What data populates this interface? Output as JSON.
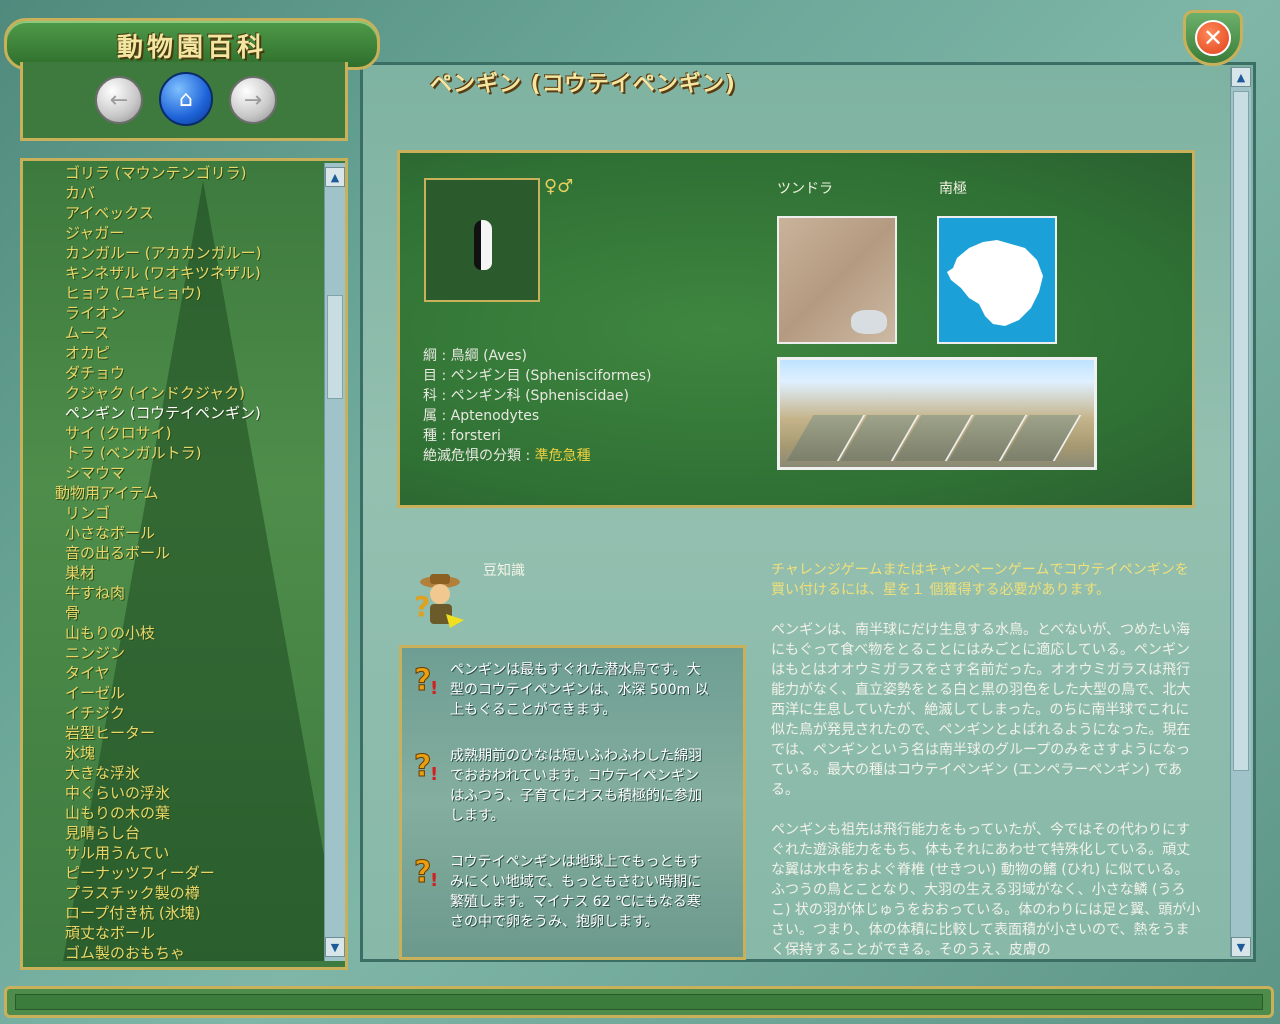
{
  "app": {
    "title": "動物園百科"
  },
  "nav": {
    "back_label": "←",
    "home_label": "⌂",
    "forward_label": "→"
  },
  "close": {
    "label": "✕"
  },
  "sidebar": {
    "items": [
      {
        "label": "ゴリラ (マウンテンゴリラ)",
        "indent": 1
      },
      {
        "label": "カバ",
        "indent": 1
      },
      {
        "label": "アイベックス",
        "indent": 1
      },
      {
        "label": "ジャガー",
        "indent": 1
      },
      {
        "label": "カンガルー (アカカンガルー)",
        "indent": 1
      },
      {
        "label": "キンネザル (ワオキツネザル)",
        "indent": 1
      },
      {
        "label": "ヒョウ (ユキヒョウ)",
        "indent": 1
      },
      {
        "label": "ライオン",
        "indent": 1
      },
      {
        "label": "ムース",
        "indent": 1
      },
      {
        "label": "オカピ",
        "indent": 1
      },
      {
        "label": "ダチョウ",
        "indent": 1
      },
      {
        "label": "クジャク (インドクジャク)",
        "indent": 1
      },
      {
        "label": "ペンギン (コウテイペンギン)",
        "indent": 1,
        "selected": true
      },
      {
        "label": "サイ (クロサイ)",
        "indent": 1
      },
      {
        "label": "トラ (ベンガルトラ)",
        "indent": 1
      },
      {
        "label": "シマウマ",
        "indent": 1
      },
      {
        "label": "動物用アイテム",
        "indent": 0
      },
      {
        "label": "リンゴ",
        "indent": 1
      },
      {
        "label": "小さなボール",
        "indent": 1
      },
      {
        "label": "音の出るボール",
        "indent": 1
      },
      {
        "label": "巣材",
        "indent": 1
      },
      {
        "label": "牛すね肉",
        "indent": 1
      },
      {
        "label": "骨",
        "indent": 1
      },
      {
        "label": "山もりの小枝",
        "indent": 1
      },
      {
        "label": "ニンジン",
        "indent": 1
      },
      {
        "label": "タイヤ",
        "indent": 1
      },
      {
        "label": "イーゼル",
        "indent": 1
      },
      {
        "label": "イチジク",
        "indent": 1
      },
      {
        "label": "岩型ヒーター",
        "indent": 1
      },
      {
        "label": "氷塊",
        "indent": 1
      },
      {
        "label": "大きな浮氷",
        "indent": 1
      },
      {
        "label": "中ぐらいの浮氷",
        "indent": 1
      },
      {
        "label": "山もりの木の葉",
        "indent": 1
      },
      {
        "label": "見晴らし台",
        "indent": 1
      },
      {
        "label": "サル用うんてい",
        "indent": 1
      },
      {
        "label": "ピーナッツフィーダー",
        "indent": 1
      },
      {
        "label": "プラスチック製の樽",
        "indent": 1
      },
      {
        "label": "ロープ付き杭 (氷塊)",
        "indent": 1
      },
      {
        "label": "頑丈なボール",
        "indent": 1
      },
      {
        "label": "ゴム製のおもちゃ",
        "indent": 1
      }
    ]
  },
  "main": {
    "title": "ペンギン (コウテイペンギン)",
    "gender_symbols": "♀♂",
    "habitats": {
      "tundra_label": "ツンドラ",
      "continent_label": "南極"
    },
    "taxonomy": [
      {
        "key": "綱",
        "value": "鳥綱 (Aves)"
      },
      {
        "key": "目",
        "value": "ペンギン目 (Sphenisciformes)"
      },
      {
        "key": "科",
        "value": "ペンギン科 (Spheniscidae)"
      },
      {
        "key": "属",
        "value": "Aptenodytes"
      },
      {
        "key": "種",
        "value": "forsteri"
      }
    ],
    "endangered": {
      "label": "絶滅危惧の分類 : ",
      "value": "準危急種",
      "color": "#f0d040"
    },
    "trivia": {
      "heading": "豆知識",
      "tips": [
        "ペンギンは最もすぐれた潜水鳥です。大型のコウテイペンギンは、水深 500m 以上もぐることができます。",
        "成熟期前のひなは短いふわふわした綿羽でおおわれています。コウテイペンギンはふつう、子育てにオスも積極的に参加します。",
        "コウテイペンギンは地球上でもっともすみにくい地域で、もっともさむい時期に繁殖します。マイナス 62 ℃にもなる寒さの中で卵をうみ、抱卵します。"
      ]
    },
    "description": {
      "intro": "チャレンジゲームまたはキャンペーンゲームでコウテイペンギンを買い付けるには、星を１ 個獲得する必要があります。",
      "paragraphs": [
        "ペンギンは、南半球にだけ生息する水鳥。とべないが、つめたい海にもぐって食べ物をとることにはみごとに適応している。ペンギンはもとはオオウミガラスをさす名前だった。オオウミガラスは飛行能力がなく、直立姿勢をとる白と黒の羽色をした大型の鳥で、北大西洋に生息していたが、絶滅してしまった。のちに南半球でこれに似た鳥が発見されたので、ペンギンとよばれるようになった。現在では、ペンギンという名は南半球のグループのみをさすようになっている。最大の種はコウテイペンギン (エンペラーペンギン) である。",
        "ペンギンも祖先は飛行能力をもっていたが、今ではその代わりにすぐれた遊泳能力をもち、体もそれにあわせて特殊化している。頑丈な翼は水中をおよぐ脊椎 (せきつい) 動物の鰭 (ひれ) に似ている。ふつうの鳥とことなり、大羽の生える羽域がなく、小さな鱗 (うろこ) 状の羽が体じゅうをおおっている。体のわりには足と翼、頭が小さい。つまり、体の体積に比較して表面積が小さいので、熱をうまく保持することができる。そのうえ、皮膚の"
      ]
    }
  },
  "colors": {
    "accent_gold": "#c8b15a",
    "list_text": "#e8d86a",
    "selected_text": "#ffffff"
  }
}
